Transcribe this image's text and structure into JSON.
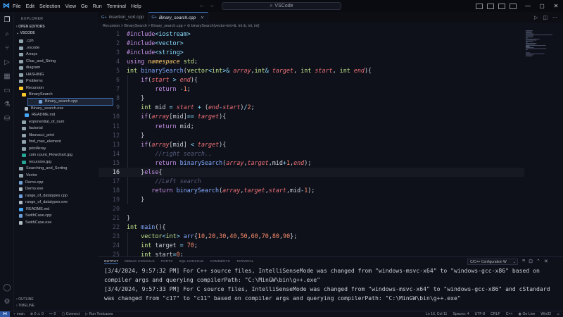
{
  "titlebar": {
    "menu": [
      "File",
      "Edit",
      "Selection",
      "View",
      "Go",
      "Run",
      "Terminal",
      "Help"
    ],
    "search": "VSCode"
  },
  "sidebar": {
    "header": "EXPLORER",
    "open_editors": "OPEN EDITORS",
    "folder": "VSCODE",
    "items": [
      {
        "label": ".cph",
        "type": "folder",
        "depth": 1
      },
      {
        "label": ".vscode",
        "type": "folder",
        "depth": 1
      },
      {
        "label": "Arrays",
        "type": "folder",
        "depth": 1
      },
      {
        "label": "Char_and_String",
        "type": "folder",
        "depth": 1
      },
      {
        "label": "diagram",
        "type": "folder",
        "depth": 1
      },
      {
        "label": "HASHING",
        "type": "folder",
        "depth": 1
      },
      {
        "label": "Problems",
        "type": "folder",
        "depth": 1
      },
      {
        "label": "Recursion",
        "type": "folder-open",
        "depth": 1
      },
      {
        "label": "BinarySearch",
        "type": "folder-open",
        "depth": 2
      },
      {
        "label": "Binary_search.cpp",
        "type": "cpp",
        "depth": 3,
        "selected": true
      },
      {
        "label": "Binary_search.exe",
        "type": "exe",
        "depth": 3
      },
      {
        "label": "README.md",
        "type": "md",
        "depth": 3
      },
      {
        "label": "exponential_of_num",
        "type": "folder",
        "depth": 2
      },
      {
        "label": "factorial",
        "type": "folder",
        "depth": 2
      },
      {
        "label": "fibonacci_print",
        "type": "folder",
        "depth": 2
      },
      {
        "label": "find_max_element",
        "type": "folder",
        "depth": 2
      },
      {
        "label": "printArray",
        "type": "folder",
        "depth": 2
      },
      {
        "label": "coin count_Flowchart.jpg",
        "type": "img",
        "depth": 2
      },
      {
        "label": "recursion.jpg",
        "type": "img",
        "depth": 2
      },
      {
        "label": "Searching_and_Sorting",
        "type": "folder",
        "depth": 1
      },
      {
        "label": "Vector",
        "type": "folder",
        "depth": 1
      },
      {
        "label": "Demo.cpp",
        "type": "cpp",
        "depth": 1
      },
      {
        "label": "Demo.exe",
        "type": "exe",
        "depth": 1
      },
      {
        "label": "range_of_datatypes.cpp",
        "type": "cpp",
        "depth": 1
      },
      {
        "label": "range_of_datatypes.exe",
        "type": "exe",
        "depth": 1
      },
      {
        "label": "README.md",
        "type": "md",
        "depth": 1
      },
      {
        "label": "SwithCase.cpp",
        "type": "cpp",
        "depth": 1
      },
      {
        "label": "SwithCase.exe",
        "type": "exe",
        "depth": 1
      }
    ],
    "outline": "OUTLINE",
    "timeline": "TIMELINE"
  },
  "tabs": [
    {
      "label": "insertion_sort.cpp",
      "active": false
    },
    {
      "label": "Binary_search.cpp",
      "active": true
    }
  ],
  "breadcrumb": "Recursion > BinarySearch > Binary_search.cpp > ⊘ binarySearch(vector<int>&, int &, int, int)",
  "code": {
    "current_line": 16,
    "lines": [
      [
        [
          "t-pp",
          "#include"
        ],
        [
          "t-op",
          "<iostream>"
        ]
      ],
      [
        [
          "t-pp",
          "#include"
        ],
        [
          "t-op",
          "<vector>"
        ]
      ],
      [
        [
          "t-pp",
          "#include"
        ],
        [
          "t-op",
          "<string>"
        ]
      ],
      [
        [
          "t-kw",
          "using "
        ],
        [
          "t-ns",
          "namespace "
        ],
        [
          "t-ty",
          "std"
        ],
        [
          "t-pu",
          ";"
        ]
      ],
      [
        [
          "t-ty",
          "int "
        ],
        [
          "t-fn",
          "binarySearch"
        ],
        [
          "t-pu",
          "("
        ],
        [
          "t-ty",
          "vector"
        ],
        [
          "t-op",
          "<"
        ],
        [
          "t-ty",
          "int"
        ],
        [
          "t-op",
          ">& "
        ],
        [
          "t-va",
          "array"
        ],
        [
          "t-pu",
          ","
        ],
        [
          "t-ty",
          "int"
        ],
        [
          "t-op",
          "& "
        ],
        [
          "t-va",
          "target"
        ],
        [
          "t-pu",
          ", "
        ],
        [
          "t-ty",
          "int "
        ],
        [
          "t-va",
          "start"
        ],
        [
          "t-pu",
          ", "
        ],
        [
          "t-ty",
          "int "
        ],
        [
          "t-va",
          "end"
        ],
        [
          "t-pu",
          "){"
        ]
      ],
      [
        [
          "t-pl",
          "    "
        ],
        [
          "t-kw",
          "if"
        ],
        [
          "t-pu",
          "("
        ],
        [
          "t-va",
          "start "
        ],
        [
          "t-op",
          "> "
        ],
        [
          "t-va",
          "end"
        ],
        [
          "t-pu",
          "){"
        ]
      ],
      [
        [
          "t-pl",
          "        "
        ],
        [
          "t-kw",
          "return "
        ],
        [
          "t-op",
          "-"
        ],
        [
          "t-nu",
          "1"
        ],
        [
          "t-pu",
          ";"
        ]
      ],
      [
        [
          "t-pl",
          "    "
        ],
        [
          "t-pu",
          "}"
        ]
      ],
      [
        [
          "t-pl",
          "    "
        ],
        [
          "t-ty",
          "int "
        ],
        [
          "t-pl",
          "mid "
        ],
        [
          "t-op",
          "= "
        ],
        [
          "t-va",
          "start "
        ],
        [
          "t-op",
          "+ "
        ],
        [
          "t-pu",
          "("
        ],
        [
          "t-va",
          "end"
        ],
        [
          "t-op",
          "-"
        ],
        [
          "t-va",
          "start"
        ],
        [
          "t-pu",
          ")"
        ],
        [
          "t-op",
          "/"
        ],
        [
          "t-nu",
          "2"
        ],
        [
          "t-pu",
          ";"
        ]
      ],
      [
        [
          "t-pl",
          "    "
        ],
        [
          "t-kw",
          "if"
        ],
        [
          "t-pu",
          "("
        ],
        [
          "t-va",
          "array"
        ],
        [
          "t-pu",
          "["
        ],
        [
          "t-pl",
          "mid"
        ],
        [
          "t-pu",
          "]"
        ],
        [
          "t-op",
          "== "
        ],
        [
          "t-va",
          "target"
        ],
        [
          "t-pu",
          "){"
        ]
      ],
      [
        [
          "t-pl",
          "        "
        ],
        [
          "t-kw",
          "return "
        ],
        [
          "t-pl",
          "mid"
        ],
        [
          "t-pu",
          ";"
        ]
      ],
      [
        [
          "t-pl",
          "    "
        ],
        [
          "t-pu",
          "}"
        ]
      ],
      [
        [
          "t-pl",
          "    "
        ],
        [
          "t-kw",
          "if"
        ],
        [
          "t-pu",
          "("
        ],
        [
          "t-va",
          "array"
        ],
        [
          "t-pu",
          "["
        ],
        [
          "t-pl",
          "mid"
        ],
        [
          "t-pu",
          "] "
        ],
        [
          "t-op",
          "< "
        ],
        [
          "t-va",
          "target"
        ],
        [
          "t-pu",
          "){"
        ]
      ],
      [
        [
          "t-pl",
          "        "
        ],
        [
          "t-cm",
          "//right search.."
        ]
      ],
      [
        [
          "t-pl",
          "        "
        ],
        [
          "t-kw",
          "return "
        ],
        [
          "t-fn",
          "binarySearch"
        ],
        [
          "t-pu",
          "("
        ],
        [
          "t-va",
          "array"
        ],
        [
          "t-pu",
          ","
        ],
        [
          "t-va",
          "target"
        ],
        [
          "t-pu",
          ","
        ],
        [
          "t-pl",
          "mid"
        ],
        [
          "t-op",
          "+"
        ],
        [
          "t-nu",
          "1"
        ],
        [
          "t-pu",
          ","
        ],
        [
          "t-va",
          "end"
        ],
        [
          "t-pu",
          ");"
        ]
      ],
      [
        [
          "t-pl",
          "    "
        ],
        [
          "t-br",
          "}"
        ],
        [
          "t-kw",
          "else"
        ],
        [
          "t-br",
          "{"
        ]
      ],
      [
        [
          "t-pl",
          "        "
        ],
        [
          "t-cm",
          "//Left search"
        ]
      ],
      [
        [
          "t-pl",
          "       "
        ],
        [
          "t-kw",
          "return "
        ],
        [
          "t-fn",
          "binarySearch"
        ],
        [
          "t-pu",
          "("
        ],
        [
          "t-va",
          "array"
        ],
        [
          "t-pu",
          ","
        ],
        [
          "t-va",
          "target"
        ],
        [
          "t-pu",
          ","
        ],
        [
          "t-va",
          "start"
        ],
        [
          "t-pu",
          ","
        ],
        [
          "t-pl",
          "mid"
        ],
        [
          "t-op",
          "-"
        ],
        [
          "t-nu",
          "1"
        ],
        [
          "t-pu",
          ");"
        ]
      ],
      [
        [
          "t-pl",
          "    "
        ],
        [
          "t-pu",
          "}"
        ]
      ],
      [],
      [
        [
          "t-pu",
          "}"
        ]
      ],
      [
        [
          "t-ty",
          "int "
        ],
        [
          "t-fn",
          "main"
        ],
        [
          "t-pu",
          "(){"
        ]
      ],
      [
        [
          "t-pl",
          "    "
        ],
        [
          "t-ty",
          "vector"
        ],
        [
          "t-op",
          "<"
        ],
        [
          "t-ty",
          "int"
        ],
        [
          "t-op",
          "> "
        ],
        [
          "t-fn",
          "arr"
        ],
        [
          "t-pu",
          "{"
        ],
        [
          "t-nu",
          "10"
        ],
        [
          "t-pu",
          ","
        ],
        [
          "t-nu",
          "20"
        ],
        [
          "t-pu",
          ","
        ],
        [
          "t-nu",
          "30"
        ],
        [
          "t-pu",
          ","
        ],
        [
          "t-nu",
          "40"
        ],
        [
          "t-pu",
          ","
        ],
        [
          "t-nu",
          "50"
        ],
        [
          "t-pu",
          ","
        ],
        [
          "t-nu",
          "60"
        ],
        [
          "t-pu",
          ","
        ],
        [
          "t-nu",
          "70"
        ],
        [
          "t-pu",
          ","
        ],
        [
          "t-nu",
          "80"
        ],
        [
          "t-pu",
          ","
        ],
        [
          "t-nu",
          "90"
        ],
        [
          "t-pu",
          "};"
        ]
      ],
      [
        [
          "t-pl",
          "    "
        ],
        [
          "t-ty",
          "int "
        ],
        [
          "t-pl",
          "target "
        ],
        [
          "t-op",
          "= "
        ],
        [
          "t-nu",
          "70"
        ],
        [
          "t-pu",
          ";"
        ]
      ],
      [
        [
          "t-pl",
          "    "
        ],
        [
          "t-ty",
          "int "
        ],
        [
          "t-pl",
          "start"
        ],
        [
          "t-op",
          "="
        ],
        [
          "t-nu",
          "0"
        ],
        [
          "t-pu",
          ";"
        ]
      ]
    ]
  },
  "panel": {
    "tabs": [
      "OUTPUT",
      "DEBUG CONSOLE",
      "PORTS",
      "SQL CONSOLE",
      "COMMENTS",
      "TERMINAL"
    ],
    "dropdown": "C/C++ Configuration W",
    "output": [
      "[3/4/2024, 9:57:32 PM] For C++ source files, IntelliSenseMode was changed from \"windows-msvc-x64\" to \"windows-gcc-x86\" based on compiler args and querying compilerPath: \"C:\\MinGW\\bin\\g++.exe\"",
      "[3/4/2024, 9:57:33 PM] For C source files, IntelliSenseMode was changed from \"windows-msvc-x64\" to \"windows-gcc-x86\" and cStandard was changed from \"c17\" to \"c11\" based on compiler args and querying compilerPath: \"C:\\MinGW\\bin\\g++.exe\""
    ]
  },
  "status": {
    "branch": "main",
    "errors": "⊗ 0 ⚠ 0",
    "ports": "0",
    "live_share": "Connect",
    "run_testcases": "Run Testcases",
    "position": "Ln 16, Col 11",
    "spaces": "Spaces: 4",
    "encoding": "UTF-8",
    "eol": "CRLF",
    "language": "C++",
    "golive": "Go Live",
    "platform": "Win32"
  },
  "colors": {
    "accent": "#3d6fb3",
    "background": "#0f111a"
  }
}
